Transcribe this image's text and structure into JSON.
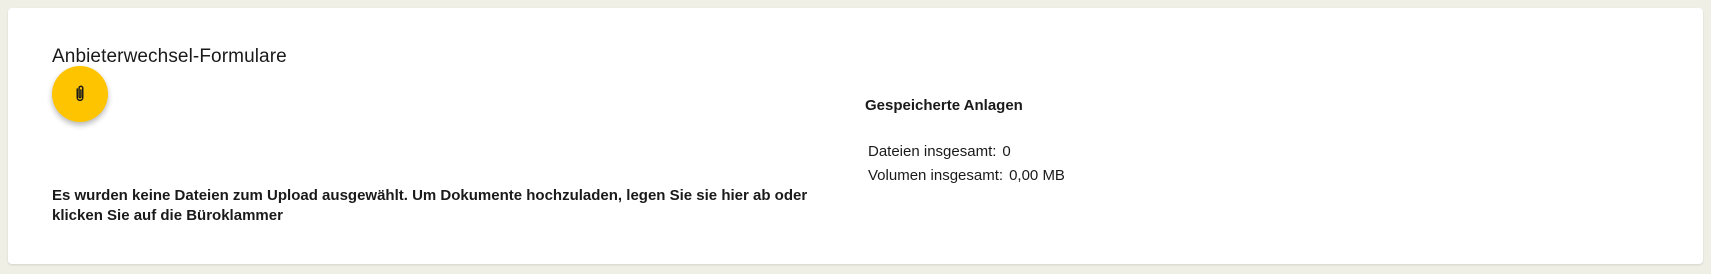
{
  "section": {
    "title": "Anbieterwechsel-Formulare",
    "attach_icon": "paperclip-icon",
    "upload_message": "Es wurden keine Dateien zum Upload ausgewählt. Um Dokumente hochzuladen, legen Sie sie hier ab oder klicken Sie auf die Büroklammer"
  },
  "saved": {
    "title": "Gespeicherte Anlagen",
    "files_label": "Dateien insgesamt:",
    "files_value": "0",
    "volume_label": "Volumen insgesamt:",
    "volume_value": "0,00 MB"
  },
  "colors": {
    "accent": "#ffc400",
    "page_bg": "#efefe6",
    "card_bg": "#ffffff"
  }
}
